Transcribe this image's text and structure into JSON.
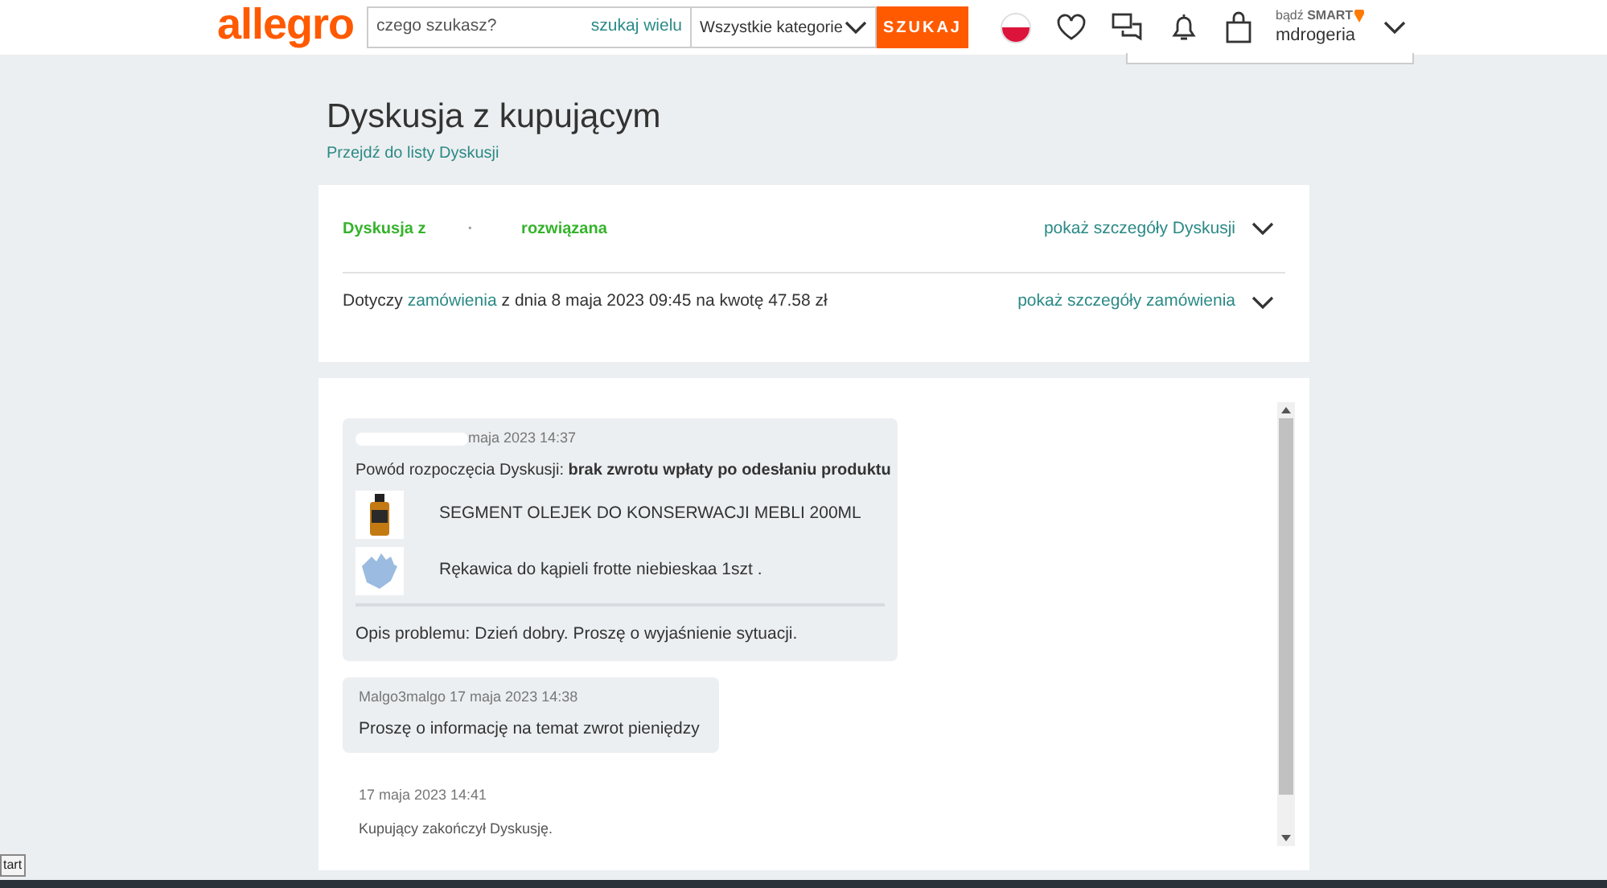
{
  "header": {
    "logo": "allegro",
    "search_placeholder": "czego szukasz?",
    "multi_search_link": "szukaj wielu",
    "category": "Wszystkie kategorie",
    "search_button": "SZUKAJ",
    "smart": "bądź **SMART**",
    "user": "mdrogeria"
  },
  "page": {
    "title": "Dyskusja z kupującym",
    "back_link": "Przejdź do listy Dyskusji"
  },
  "discussion": {
    "label": "Dyskusja z",
    "separator": "·",
    "status": "rozwiązana",
    "details_link": "pokaż szczegóły Dyskusji",
    "order_prefix": "Dotyczy",
    "order_link": "zamówienia",
    "order_text": "z dnia 8 maja 2023 09:45 na kwotę 47.58 zł",
    "order_details_link": "pokaż szczegóły zamówienia"
  },
  "messages": [
    {
      "kind": "opening",
      "meta": "maja 2023 14:37",
      "author_hidden": true,
      "reason": "Powód rozpoczęcia Dyskusji: **brak zwrotu wpłaty po odesłaniu produktu**",
      "products": [
        {
          "name": "SEGMENT OLEJEK DO KONSERWACJI MEBLI 200ML",
          "kind": "bottle"
        },
        {
          "name": "Rękawica do kąpieli frotte niebieskaa 1szt .",
          "kind": "glove"
        }
      ],
      "text": "Opis problemu: Dzień dobry. Proszę o wyjaśnienie sytuacji."
    },
    {
      "kind": "message",
      "meta": "Malgo3malgo 17 maja 2023 14:38",
      "text": "Proszę o informację na temat zwrot pieniędzy"
    },
    {
      "kind": "event",
      "meta": "17 maja 2023 14:41",
      "text": "Kupujący zakończył Dyskusję."
    }
  ],
  "taskbar": {
    "tooltip": "tart"
  }
}
